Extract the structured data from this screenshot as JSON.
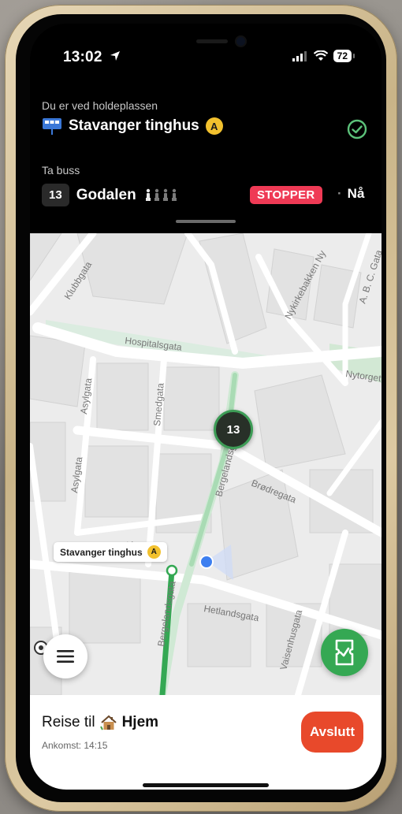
{
  "status_bar": {
    "time": "13:02",
    "battery": "72"
  },
  "header": {
    "at_stop_label": "Du er ved holdeplassen",
    "stop_name": "Stavanger tinghus",
    "stop_platform": "A",
    "take_bus_label": "Ta buss",
    "route_number": "13",
    "destination": "Godalen",
    "stop_badge": "STOPPER",
    "departure": "Nå"
  },
  "map": {
    "streets": [
      "Klubbgata",
      "Hospitalsgata",
      "Nytorget",
      "Nykirkebakken Ny",
      "A. B. C. Gata",
      "Asylgata",
      "Smedgata",
      "Bergelandsgata",
      "Brødregata",
      "Pedersbakken",
      "Hetlandsgata",
      "Vaisenhusgata"
    ],
    "bus_marker": "13",
    "stop_label": "Stavanger tinghus",
    "stop_label_platform": "A"
  },
  "trip": {
    "prefix": "Reise til",
    "destination": "Hjem",
    "arrival": "Ankomst: 14:15",
    "end_button": "Avslutt"
  },
  "colors": {
    "accent_green": "#35a853",
    "stopper_red": "#ef3a55",
    "end_orange": "#e8492b",
    "platform_yellow": "#f2c12e"
  }
}
